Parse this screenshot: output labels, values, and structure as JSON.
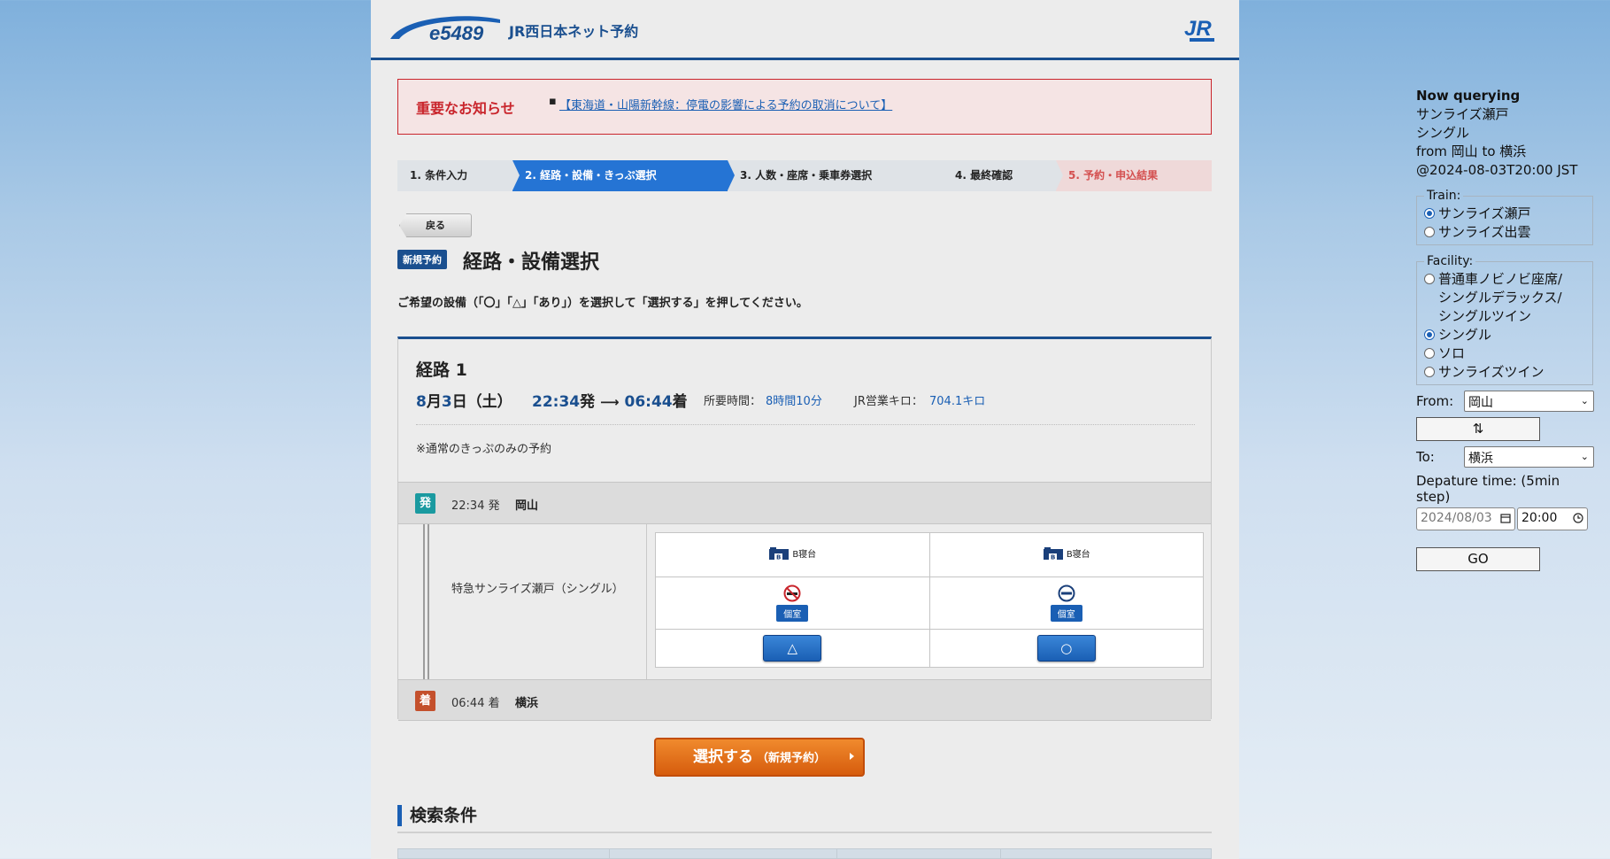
{
  "header": {
    "logo_text": "e5489",
    "site_title": "JR西日本ネット予約",
    "jr_logo_text": "JR"
  },
  "notice": {
    "title": "重要なお知らせ",
    "link": "【東海道・山陽新幹線：停電の影響による予約の取消について】"
  },
  "steps": [
    {
      "label": "1.  条件入力"
    },
    {
      "label": "2.  経路・設備・きっぷ選択"
    },
    {
      "label": "3.  人数・座席・乗車券選択"
    },
    {
      "label": "4.  最終確認"
    },
    {
      "label": "5.  予約・申込結果"
    }
  ],
  "back_button": "戻る",
  "new_badge": "新規予約",
  "page_title": "経路・設備選択",
  "instruction": "ご希望の設備（「〇」「△」「あり」）を選択して「選択する」を押してください。",
  "route": {
    "title": "経路 1",
    "date_month": "8",
    "date_month_unit": "月",
    "date_day": "3",
    "date_day_unit": "日（土）",
    "dep_time": "22:34",
    "dep_suffix": "発",
    "arr_time": "06:44",
    "arr_suffix": "着",
    "duration_label": "所要時間：",
    "duration": "8時間10分",
    "km_label": "JR営業キロ：",
    "km": "704.1キロ",
    "note": "※通常のきっぷのみの予約"
  },
  "departure": {
    "icon": "発",
    "time": "22:34 発",
    "station": "岡山"
  },
  "arrival": {
    "icon": "着",
    "time": "06:44 着",
    "station": "横浜"
  },
  "train": {
    "name": "特急サンライズ瀬戸（シングル）"
  },
  "facilities": [
    {
      "type": "B寝台",
      "type_icon": "bed-b-icon",
      "smoking": "no-smoking-icon",
      "room": "個室",
      "availability": "△"
    },
    {
      "type": "B寝台",
      "type_icon": "bed-b-icon",
      "smoking": "no-entry-icon",
      "room": "個室",
      "availability": "○"
    }
  ],
  "submit": {
    "main": "選択する",
    "sub": "（新規予約）"
  },
  "conditions_title": "検索条件",
  "panel": {
    "heading": "Now querying",
    "train": "サンライズ瀬戸",
    "facility": "シングル",
    "route_line": "from 岡山 to 横浜",
    "datetime_line": "@2024-08-03T20:00 JST",
    "train_legend": "Train:",
    "train_options": [
      {
        "label": "サンライズ瀬戸",
        "selected": true
      },
      {
        "label": "サンライズ出雲",
        "selected": false
      }
    ],
    "facility_legend": "Facility:",
    "facility_options": [
      {
        "label": "普通車ノビノビ座席/",
        "selected": false
      },
      {
        "label": "シングルデラックス/",
        "selected": false
      },
      {
        "label": "シングルツイン",
        "selected": false
      },
      {
        "label": "シングル",
        "selected": true
      },
      {
        "label": "ソロ",
        "selected": false
      },
      {
        "label": "サンライズツイン",
        "selected": false
      }
    ],
    "from_label": "From:",
    "from_value": "岡山",
    "swap_label": "⇅",
    "to_label": "To:",
    "to_value": "横浜",
    "departure_label": "Depature time: (5min step)",
    "date_value": "2024/08/03",
    "time_value": "20:00",
    "go_label": "GO"
  },
  "colors": {
    "accent": "#1a4f8f",
    "step_active": "#2574d4",
    "notice_red": "#c9252c",
    "submit_orange": "#e07019"
  }
}
